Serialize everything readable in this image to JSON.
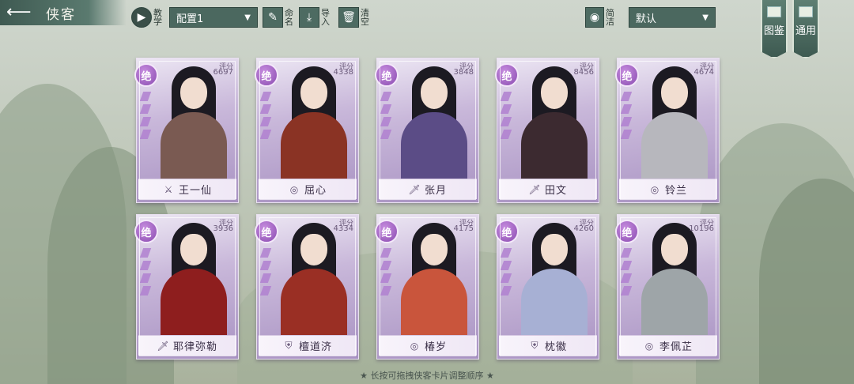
{
  "header": {
    "title": "侠客",
    "tutorial_label": "教学",
    "preset_select": "配置1",
    "rename_label": "命名",
    "import_label": "导入",
    "clear_label": "清空",
    "simple_label": "简洁",
    "sort_select": "默认",
    "codex_tab": "图鉴",
    "general_tab": "通用"
  },
  "cards": [
    {
      "rank": "绝",
      "score_label": "评分",
      "score": "6697",
      "name": "王一仙",
      "type_icon": "sword-icon",
      "outfit": "#7a5a52"
    },
    {
      "rank": "绝",
      "score_label": "评分",
      "score": "4338",
      "name": "屈心",
      "type_icon": "swirl-icon",
      "outfit": "#8a3324"
    },
    {
      "rank": "绝",
      "score_label": "评分",
      "score": "3848",
      "name": "张月",
      "type_icon": "blade-icon",
      "outfit": "#5b4c86"
    },
    {
      "rank": "绝",
      "score_label": "评分",
      "score": "8456",
      "name": "田文",
      "type_icon": "blade-icon",
      "outfit": "#3c2a30"
    },
    {
      "rank": "绝",
      "score_label": "评分",
      "score": "4674",
      "name": "铃兰",
      "type_icon": "swirl-icon",
      "outfit": "#b7b7bd"
    },
    {
      "rank": "绝",
      "score_label": "评分",
      "score": "3936",
      "name": "耶律弥勒",
      "type_icon": "blade-icon",
      "outfit": "#8e1e1e"
    },
    {
      "rank": "绝",
      "score_label": "评分",
      "score": "4334",
      "name": "檀道济",
      "type_icon": "shield-icon",
      "outfit": "#9a2f24"
    },
    {
      "rank": "绝",
      "score_label": "评分",
      "score": "4175",
      "name": "椿岁",
      "type_icon": "swirl-icon",
      "outfit": "#c9553c"
    },
    {
      "rank": "绝",
      "score_label": "评分",
      "score": "4260",
      "name": "枕徽",
      "type_icon": "shield-icon",
      "outfit": "#a7b0d4"
    },
    {
      "rank": "绝",
      "score_label": "评分",
      "score": "10196",
      "name": "李佩芷",
      "type_icon": "swirl-icon",
      "outfit": "#9ea5a8"
    }
  ],
  "footer": {
    "hint": "★ 长按可拖拽侠客卡片调整顺序 ★"
  }
}
